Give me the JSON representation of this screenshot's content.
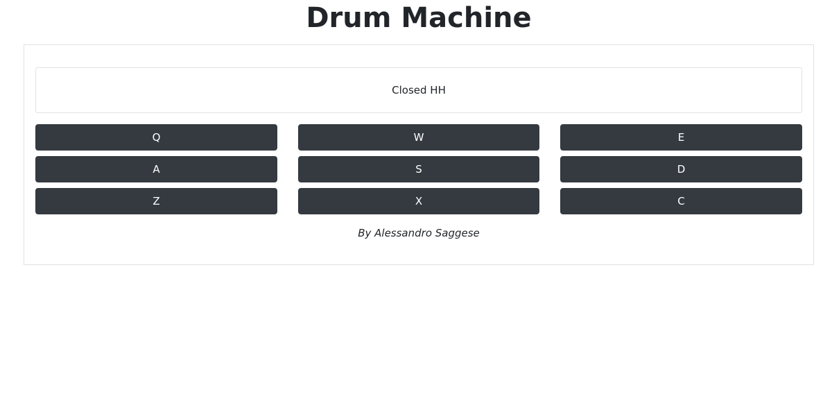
{
  "page": {
    "title": "Drum Machine"
  },
  "display": {
    "text": "Closed HH"
  },
  "pads": [
    {
      "key": "Q"
    },
    {
      "key": "W"
    },
    {
      "key": "E"
    },
    {
      "key": "A"
    },
    {
      "key": "S"
    },
    {
      "key": "D"
    },
    {
      "key": "Z"
    },
    {
      "key": "X"
    },
    {
      "key": "C"
    }
  ],
  "footer": {
    "credit": "By Alessandro Saggese"
  },
  "colors": {
    "pad_background": "#343a40",
    "pad_text": "#ffffff",
    "border": "#dee2e6",
    "text": "#212529"
  }
}
